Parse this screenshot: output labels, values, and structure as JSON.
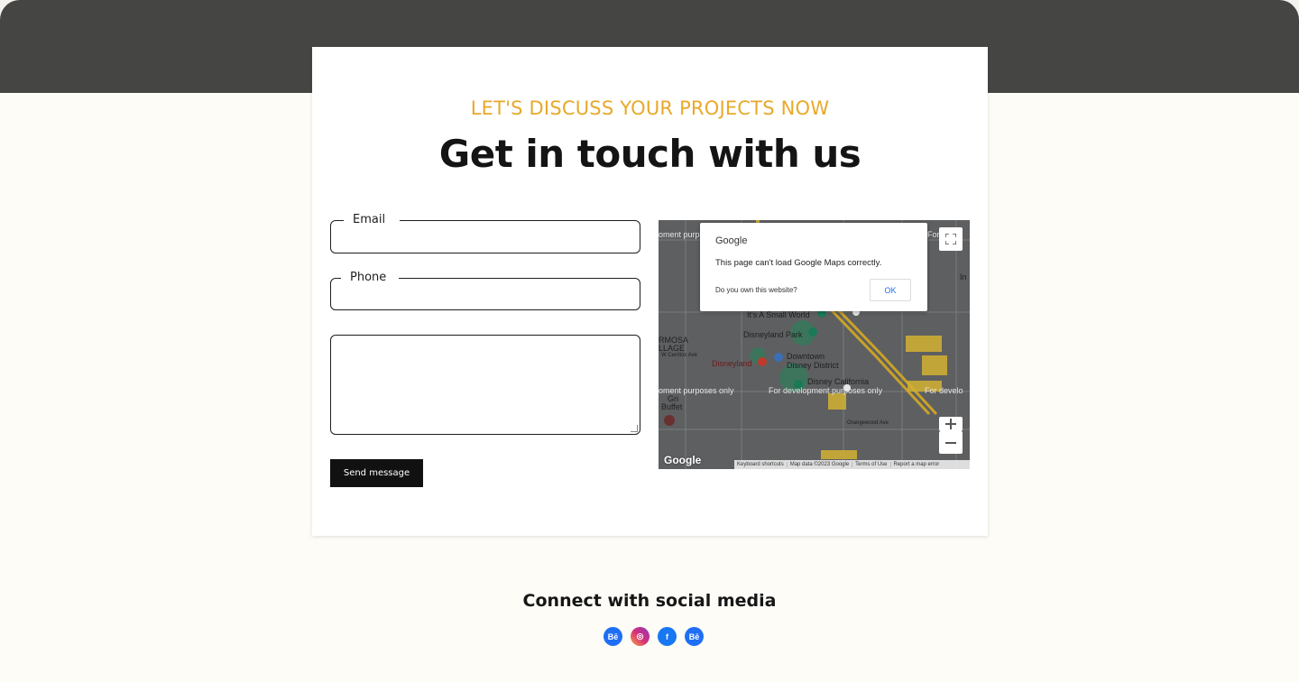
{
  "hero": {
    "kicker": "LET'S DISCUSS YOUR PROJECTS NOW",
    "title": "Get in touch with us"
  },
  "form": {
    "email_label": "Email",
    "email_value": "",
    "phone_label": "Phone",
    "phone_value": "",
    "message_value": "",
    "submit_label": "Send message"
  },
  "map": {
    "dialog": {
      "brand": "Google",
      "message": "This page can't load Google Maps correctly.",
      "link": "Do you own this website?",
      "ok_label": "OK"
    },
    "labels": {
      "dev_left_top": "oment purp",
      "dev_right_top": "For",
      "small_world": "It's A Small World",
      "disneyland_park": "Disneyland Park",
      "hermosa": "RMOSA",
      "village": "LLAGE",
      "cerritos": "W Cerritos Ave",
      "disneyland": "Disneyland",
      "downtown": "Downtown",
      "district": "Disney District",
      "disney_california": "Disney California",
      "dev_left": "oment purposes only",
      "dev_mid": "For development purposes only",
      "dev_right": "For develo",
      "grill": "Gri",
      "buffet": "Buffet",
      "orangewood": "Orangewood Ave",
      "inn": "In"
    },
    "google_logo": "Google",
    "attribution": {
      "shortcuts": "Keyboard shortcuts",
      "map_data": "Map data ©2023 Google",
      "terms": "Terms of Use",
      "report": "Report a map error"
    },
    "colors": {
      "overlay": "#5e5f61",
      "roads": "#8a8b8d",
      "highway": "#c9a227",
      "poi": "#d4b233",
      "green": "#2f7d5a"
    }
  },
  "social": {
    "title": "Connect with social media",
    "icons": [
      {
        "name": "behance-icon",
        "glyph": "Bē",
        "color": "#1f6ff5"
      },
      {
        "name": "instagram-icon",
        "glyph": "◎",
        "color": "#d62e7b"
      },
      {
        "name": "facebook-icon",
        "glyph": "f",
        "color": "#1877f2"
      },
      {
        "name": "behance-icon",
        "glyph": "Bē",
        "color": "#1f6ff5"
      }
    ]
  },
  "colors": {
    "band": "#454543",
    "background": "#fdfcf7",
    "accent": "#e8a92a",
    "button": "#111111"
  }
}
